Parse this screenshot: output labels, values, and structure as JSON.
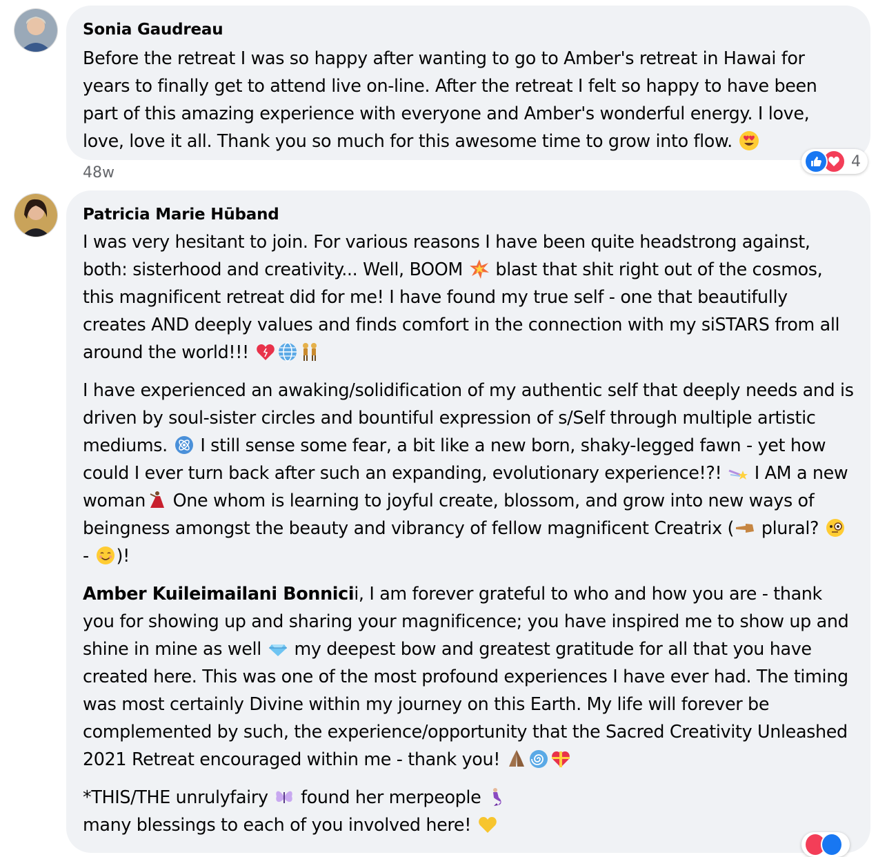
{
  "comments": [
    {
      "author": "Sonia Gaudreau",
      "text_1": "Before the retreat I was so happy after wanting to go to Amber's retreat in Hawai for years to finally get to attend live on-line. After the retreat I felt so happy to have been part of this amazing experience with everyone and Amber's wonderful energy. I love, love, love it all. Thank you so much for this awesome time to grow into flow.",
      "timestamp": "48w",
      "reaction_count": "4",
      "emojis": [
        "heart-eyes-emoji"
      ],
      "reactions": [
        "like-reaction",
        "love-reaction"
      ]
    },
    {
      "author": "Patricia Marie Hūband",
      "p1_a": "I was very hesitant to join. For various reasons I have been quite headstrong against, both: sisterhood and creativity... Well, BOOM",
      "p1_b": "blast that shit right out of the cosmos, this magnificent retreat did for me! I have found my true self - one that beautifully creates AND deeply values and finds comfort in the connection with my siSTARS from all around the world!!!",
      "p2_a": "I have experienced an awaking/solidification of my authentic self that deeply needs and is driven by soul-sister circles and bountiful expression of s/Self through multiple artistic mediums.",
      "p2_b": "I still sense some fear, a bit like a new born, shaky-legged fawn - yet how could I ever turn back after such an expanding, evolutionary experience!?!",
      "p2_c": "I AM a new woman",
      "p2_d": "One whom is learning to joyful create, blossom, and grow into new ways of beingness amongst the beauty and vibrancy of fellow magnificent Creatrix (",
      "p2_e": "plural?",
      "p2_f": "-",
      "p2_g": ")!",
      "p3_mention": "Amber Kuileimailani Bonnici",
      "p3_a": "i, I am forever grateful to who and how you are - thank you for showing up and sharing your magnificence; you have inspired me to show up and shine in mine as well",
      "p3_b": "my deepest bow and greatest gratitude for all that you have created here. This was one of the most profound experiences I have ever had. The timing was most certainly Divine within my journey on this Earth. My life will forever be complemented by such, the experience/opportunity that the Sacred Creativity Unleashed 2021 Retreat encouraged within me - thank you!",
      "p4_a": "*THIS/THE unrulyfairy",
      "p4_b": "found her merpeople",
      "p4_c": "many blessings to each of you involved here!"
    }
  ],
  "colors": {
    "bubble": "#f0f2f5",
    "meta_text": "#65676b",
    "like_blue": "#1877f2",
    "love_red": "#f33e58"
  }
}
